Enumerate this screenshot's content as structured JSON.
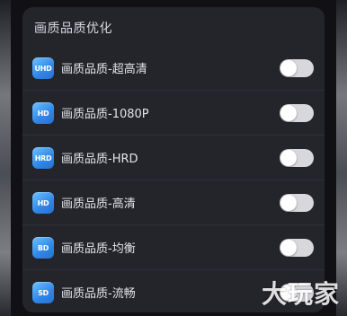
{
  "panel": {
    "title": "画质品质优化"
  },
  "items": [
    {
      "badge_icon": "uhd-badge-icon",
      "badge_text": "UHD",
      "label": "画质品质-超高清",
      "enabled": false
    },
    {
      "badge_icon": "hd-badge-icon",
      "badge_text": "HD",
      "label": "画质品质-1080P",
      "enabled": false
    },
    {
      "badge_icon": "hrd-badge-icon",
      "badge_text": "HRD",
      "label": "画质品质-HRD",
      "enabled": false
    },
    {
      "badge_icon": "hd-badge-icon",
      "badge_text": "HD",
      "label": "画质品质-高清",
      "enabled": false
    },
    {
      "badge_icon": "bd-badge-icon",
      "badge_text": "BD",
      "label": "画质品质-均衡",
      "enabled": false
    },
    {
      "badge_icon": "sd-badge-icon",
      "badge_text": "SD",
      "label": "画质品质-流畅",
      "enabled": false
    }
  ],
  "watermark": "大玩家",
  "colors": {
    "background": "#101015",
    "panel": "#24242b",
    "badge_accent": "#2f86e6",
    "toggle_off": "#d7d7dc"
  }
}
